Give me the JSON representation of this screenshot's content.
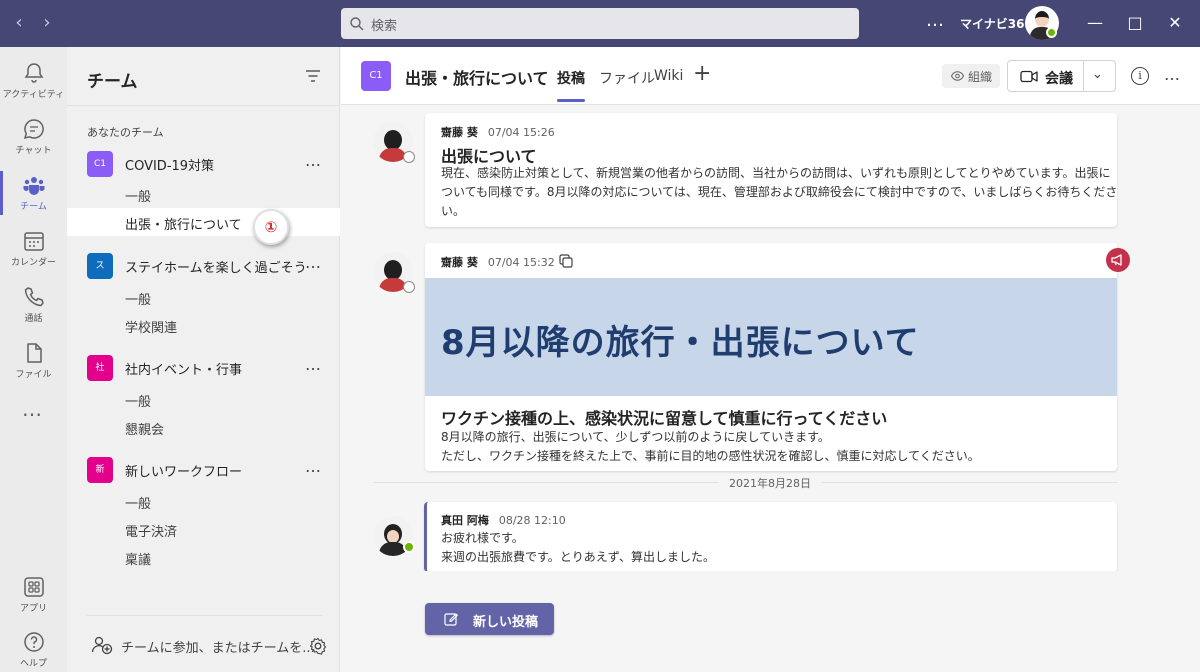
{
  "titlebar": {
    "search_placeholder": "検索",
    "org_name": "マイナビ365",
    "more": "…"
  },
  "appbar": {
    "items": [
      {
        "label": "アクティビティ",
        "icon": "bell-icon"
      },
      {
        "label": "チャット",
        "icon": "chat-icon"
      },
      {
        "label": "チーム",
        "icon": "teams-icon",
        "active": true
      },
      {
        "label": "カレンダー",
        "icon": "calendar-icon"
      },
      {
        "label": "通話",
        "icon": "phone-icon"
      },
      {
        "label": "ファイル",
        "icon": "file-icon"
      }
    ],
    "more": "…",
    "apps_label": "アプリ",
    "help_label": "ヘルプ"
  },
  "teams_panel": {
    "title": "チーム",
    "section_label": "あなたのチーム",
    "teams": [
      {
        "initials": "C1",
        "name": "COVID-19対策",
        "color": "#8b5cf6",
        "channels": [
          "一般",
          "出張・旅行について"
        ]
      },
      {
        "initials": "ス",
        "name": "ステイホームを楽しく過ごそう",
        "color": "#0f6cbd",
        "channels": [
          "一般",
          "学校関連"
        ]
      },
      {
        "initials": "社",
        "name": "社内イベント・行事",
        "color": "#e3008c",
        "channels": [
          "一般",
          "懇親会"
        ]
      },
      {
        "initials": "新",
        "name": "新しいワークフロー",
        "color": "#e3008c",
        "channels": [
          "一般",
          "電子決済",
          "稟議"
        ]
      }
    ],
    "team_more": "…",
    "step_badge": "①",
    "join_label": "チームに参加、またはチームを..."
  },
  "channel_header": {
    "initials": "C1",
    "title": "出張・旅行について",
    "tabs": [
      "投稿",
      "ファイル",
      "Wiki"
    ],
    "add_tab": "+",
    "org_label": "組織",
    "meet_label": "会議",
    "meet_chevron": "⌄",
    "info": "i",
    "more": "…"
  },
  "posts": [
    {
      "author": "齋藤 葵",
      "time": "07/04 15:26",
      "subject": "出張について",
      "body": "現在、感染防止対策として、新規営業の他者からの訪問、当社からの訪問は、いずれも原則としてとりやめています。出張についても同様です。8月以降の対応については、現在、管理部および取締役会にて検討中ですので、いましばらくお待ちください。"
    },
    {
      "author": "齋藤 葵",
      "time": "07/04 15:32",
      "banner_title": "8月以降の旅行・出張について",
      "subject": "ワクチン接種の上、感染状況に留意して慎重に行ってください",
      "body_lines": [
        "8月以降の旅行、出張について、少しずつ以前のように戻していきます。",
        "ただし、ワクチン接種を終えた上で、事前に目的地の感性状況を確認し、慎重に対応してください。"
      ]
    },
    {
      "author": "真田 阿梅",
      "time": "08/28 12:10",
      "body_lines": [
        "お疲れ様です。",
        "来週の出張旅費です。とりあえず、算出しました。"
      ]
    }
  ],
  "date_divider": "2021年8月28日",
  "new_post_label": "新しい投稿",
  "colors": {
    "accent": "#5b5fc7",
    "titlebar": "#464775",
    "announcement": "#c4314b"
  }
}
